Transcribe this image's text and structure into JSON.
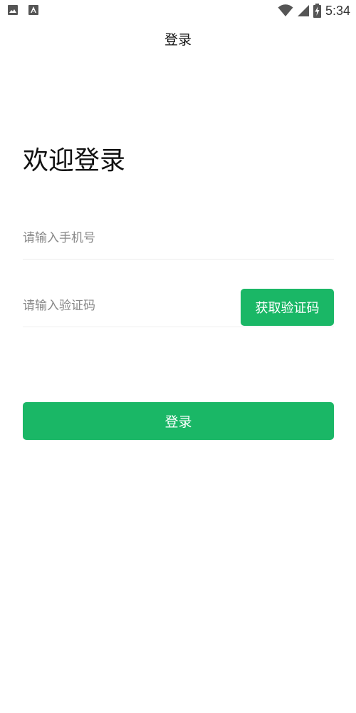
{
  "status_bar": {
    "left_icons": [
      "image-icon",
      "text-icon"
    ],
    "right_icons": [
      "wifi-icon",
      "cellular-signal-icon",
      "battery-charging-icon"
    ],
    "time": "5:34"
  },
  "header": {
    "title": "登录"
  },
  "main": {
    "welcome_text": "欢迎登录",
    "phone_input": {
      "placeholder": "请输入手机号",
      "value": ""
    },
    "code_input": {
      "placeholder": "请输入验证码",
      "value": ""
    },
    "get_code_label": "获取验证码",
    "login_label": "登录"
  },
  "colors": {
    "accent": "#1ab766",
    "divider": "#eeeeee",
    "placeholder": "#888888"
  }
}
